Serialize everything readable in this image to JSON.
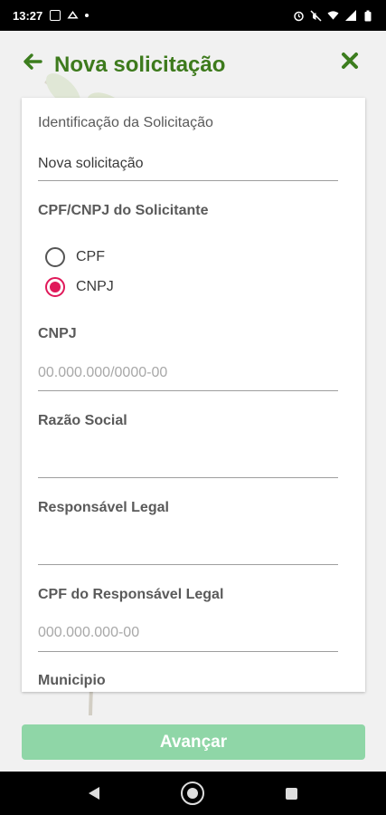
{
  "status_bar": {
    "time": "13:27",
    "left_icons": [
      "calendar-icon",
      "cloud-icon",
      "dot-icon"
    ],
    "right_icons": [
      "alarm-icon",
      "mute-icon",
      "wifi-icon",
      "signal-icon",
      "battery-icon"
    ]
  },
  "header": {
    "title": "Nova solicitação",
    "back_icon": "arrow-left-icon",
    "close_icon": "close-icon",
    "accent_color": "#3d7a1c"
  },
  "form": {
    "identification": {
      "label": "Identificação da Solicitação",
      "value": "Nova solicitação"
    },
    "cpf_cnpj": {
      "label": "CPF/CNPJ do Solicitante",
      "options": [
        {
          "label": "CPF",
          "checked": false
        },
        {
          "label": "CNPJ",
          "checked": true
        }
      ]
    },
    "cnpj": {
      "label": "CNPJ",
      "placeholder": "00.000.000/0000-00",
      "value": ""
    },
    "razao_social": {
      "label": "Razão Social",
      "value": ""
    },
    "responsavel_legal": {
      "label": "Responsável Legal",
      "value": ""
    },
    "cpf_responsavel": {
      "label": "CPF do Responsável Legal",
      "placeholder": "000.000.000-00",
      "value": ""
    },
    "municipio": {
      "label": "Municipio"
    }
  },
  "actions": {
    "advance_label": "Avançar",
    "advance_color": "#8fd6a7"
  },
  "nav": {
    "icons": [
      "nav-back-icon",
      "nav-home-icon",
      "nav-recents-icon"
    ]
  }
}
